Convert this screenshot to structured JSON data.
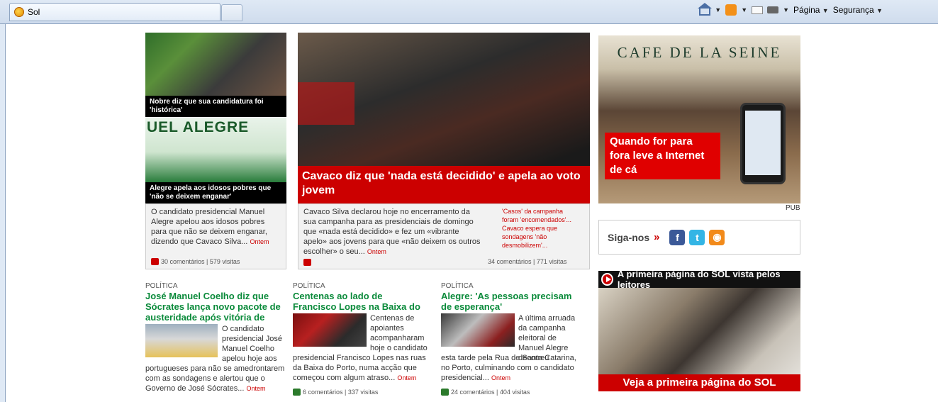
{
  "browser": {
    "tab_title": "Sol",
    "cmd_page": "Página",
    "cmd_security": "Segurança"
  },
  "top_stories": [
    {
      "caption": "Nobre diz que sua candidatura foi 'histórica'"
    },
    {
      "caption": "Alegre apela aos idosos pobres que 'não se deixem enganar'",
      "banner_text": "UEL ALEGRE"
    }
  ],
  "left_card": {
    "excerpt": "O candidato presidencial Manuel Alegre apelou aos idosos pobres para que não se deixem enganar, dizendo que Cavaco Silva...",
    "more": "Ontem",
    "meta": "30 comentários | 579 visitas"
  },
  "hero": {
    "title": "Cavaco diz que 'nada está decidido' e apela ao voto jovem",
    "excerpt": "Cavaco Silva declarou hoje no encerramento da sua campanha para as presidenciais de domingo que «nada está decidido» e fez um «vibrante apelo» aos jovens para que «não deixem os outros escolher» o seu...",
    "more": "Ontem",
    "related": "'Casos' da campanha foram 'encomendados'... Cavaco espera que sondagens 'não desmobilizem'...",
    "meta": "34 comentários | 771 visitas"
  },
  "articles": [
    {
      "section": "POLÍTICA",
      "headline": "José Manuel Coelho diz que Sócrates lança novo pacote de austeridade após vitória de Cavaco",
      "excerpt_side": "O candidato presidencial José Manuel Coelho apelou hoje aos",
      "excerpt_full": "portugueses para não se amedrontarem com as sondagens e alertou que o Governo de José Sócrates...",
      "more": "Ontem"
    },
    {
      "section": "POLÍTICA",
      "headline": "Centenas ao lado de Francisco Lopes na Baixa do Porto",
      "excerpt_side": "Centenas de apoiantes acompanharam hoje o candidato",
      "excerpt_full": "presidencial Francisco Lopes nas ruas da Baixa do Porto, numa acção que começou com algum atraso...",
      "more": "Ontem",
      "meta": "6 comentários | 337 visitas"
    },
    {
      "section": "POLÍTICA",
      "headline": "Alegre: 'As pessoas precisam de esperança'",
      "excerpt_side": "A última arruada da campanha eleitoral de Manuel Alegre decorreu",
      "excerpt_full": "esta tarde pela Rua de Santa Catarina, no Porto, culminando com o candidato presidencial...",
      "more": "Ontem",
      "meta": "24 comentários | 404 visitas"
    }
  ],
  "ad": {
    "sign": "CAFE DE LA SEINE",
    "slogan": "Quando for para fora leve a Internet de cá",
    "label": "PUB"
  },
  "follow": {
    "label": "Siga-nos",
    "arrow": "»"
  },
  "promo": {
    "head": "A primeira página do SOL vista pelos leitores",
    "foot": "Veja a primeira página do SOL"
  }
}
